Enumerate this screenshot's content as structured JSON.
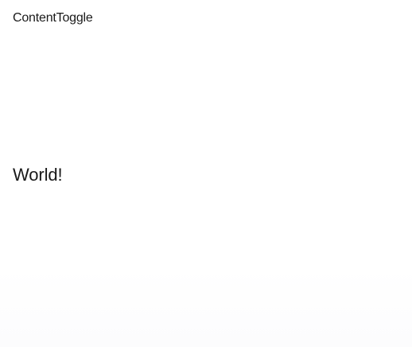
{
  "app": {
    "title": "ContentToggle"
  },
  "content": {
    "text": "World!"
  }
}
